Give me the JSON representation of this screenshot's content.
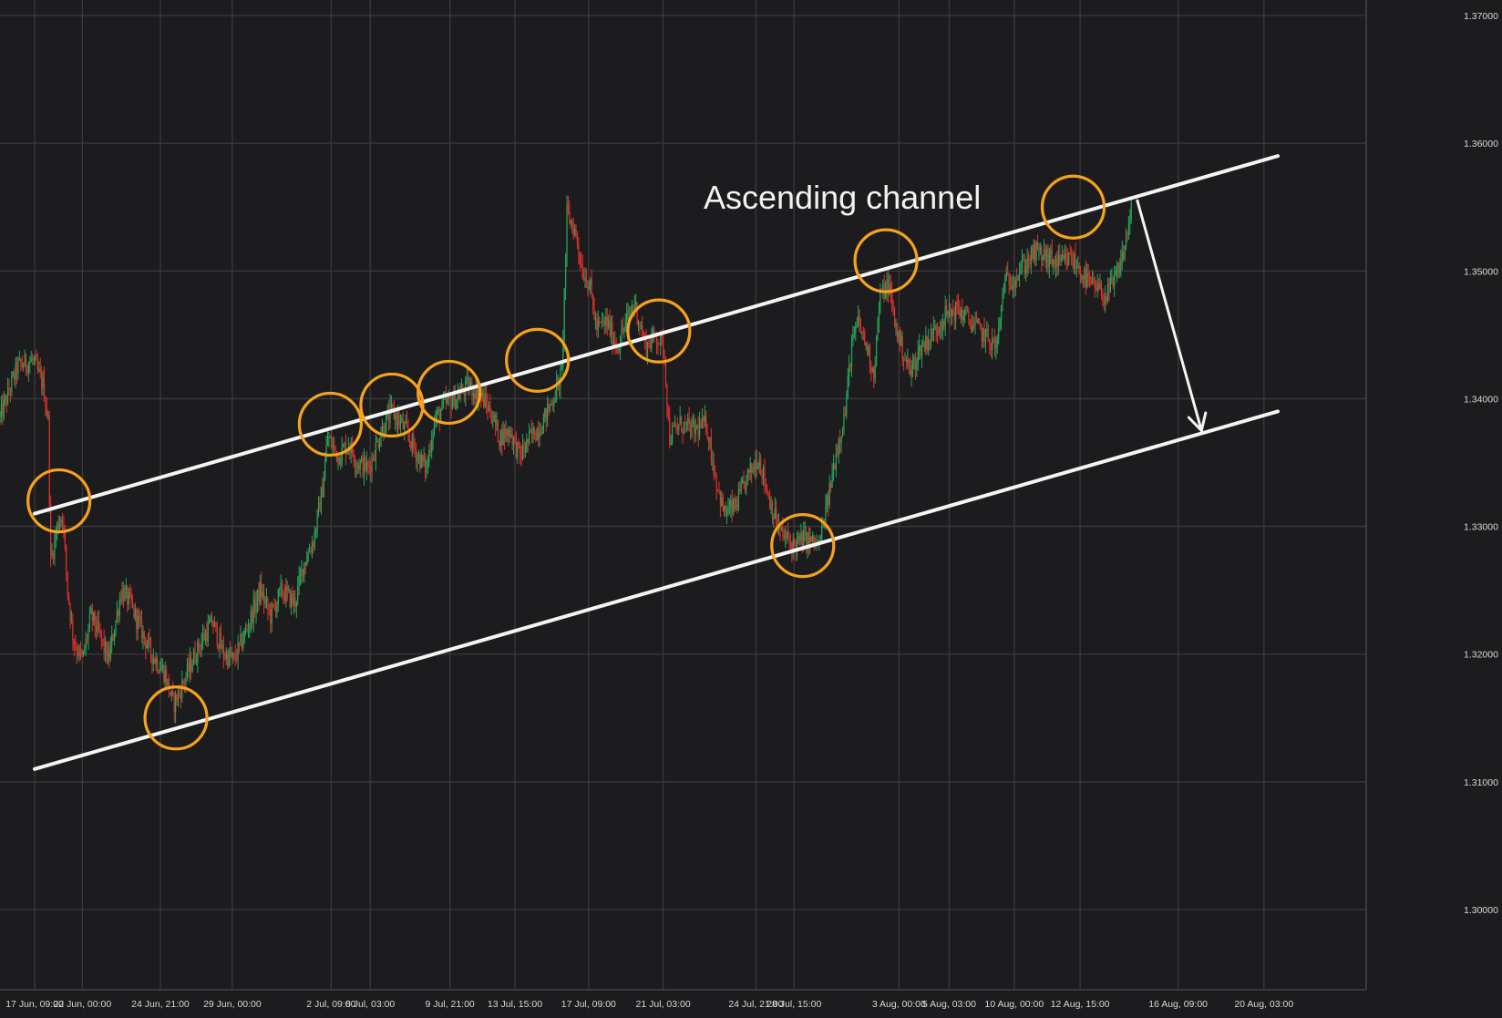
{
  "chart_data": {
    "type": "candlestick",
    "title": "Ascending channel",
    "ylim": [
      1.295,
      1.3705
    ],
    "y_ticks": [
      "1.30000",
      "1.31000",
      "1.32000",
      "1.33000",
      "1.34000",
      "1.35000",
      "1.36000",
      "1.37000"
    ],
    "y_tick_values": [
      1.3,
      1.31,
      1.32,
      1.33,
      1.34,
      1.35,
      1.36,
      1.37
    ],
    "x_ticks": [
      "17 Jun, 09:00",
      "22 Jun, 00:00",
      "24 Jun, 21:00",
      "29 Jun, 00:00",
      "2 Jul, 09:00",
      "6 Jul, 03:00",
      "9 Jul, 21:00",
      "13 Jul, 15:00",
      "17 Jul, 09:00",
      "21 Jul, 03:00",
      "24 Jul, 21:00",
      "28 Jul, 15:00",
      "3 Aug, 00:00",
      "5 Aug, 03:00",
      "10 Aug, 00:00",
      "12 Aug, 15:00",
      "16 Aug, 09:00",
      "20 Aug, 03:00"
    ],
    "x_tick_index": [
      40,
      95,
      185,
      268,
      382,
      427,
      519,
      594,
      679,
      765,
      872,
      916,
      1037,
      1095,
      1170,
      1246,
      1359,
      1458
    ],
    "grid": true,
    "colors": {
      "up": "#26a65b",
      "down": "#e0312c",
      "channel": "#f4f4f4",
      "touch": "#f6a21e",
      "background": "#1c1c1e",
      "grid": "#3a3a3d"
    },
    "price_path": [
      [
        0,
        1.3385
      ],
      [
        20,
        1.3425
      ],
      [
        38,
        1.343
      ],
      [
        50,
        1.341
      ],
      [
        56,
        1.338
      ],
      [
        58,
        1.327
      ],
      [
        66,
        1.33
      ],
      [
        72,
        1.331
      ],
      [
        78,
        1.325
      ],
      [
        85,
        1.321
      ],
      [
        95,
        1.3195
      ],
      [
        105,
        1.323
      ],
      [
        115,
        1.3215
      ],
      [
        125,
        1.3195
      ],
      [
        140,
        1.325
      ],
      [
        150,
        1.324
      ],
      [
        162,
        1.322
      ],
      [
        175,
        1.32
      ],
      [
        190,
        1.3185
      ],
      [
        200,
        1.316
      ],
      [
        210,
        1.3175
      ],
      [
        222,
        1.3195
      ],
      [
        232,
        1.321
      ],
      [
        245,
        1.3225
      ],
      [
        258,
        1.32
      ],
      [
        270,
        1.3195
      ],
      [
        285,
        1.322
      ],
      [
        300,
        1.325
      ],
      [
        312,
        1.323
      ],
      [
        325,
        1.325
      ],
      [
        340,
        1.324
      ],
      [
        350,
        1.327
      ],
      [
        362,
        1.329
      ],
      [
        372,
        1.333
      ],
      [
        378,
        1.337
      ],
      [
        390,
        1.3355
      ],
      [
        402,
        1.3365
      ],
      [
        412,
        1.335
      ],
      [
        425,
        1.3345
      ],
      [
        440,
        1.3375
      ],
      [
        452,
        1.339
      ],
      [
        468,
        1.3375
      ],
      [
        482,
        1.3355
      ],
      [
        492,
        1.3345
      ],
      [
        500,
        1.338
      ],
      [
        512,
        1.3395
      ],
      [
        525,
        1.34
      ],
      [
        540,
        1.341
      ],
      [
        552,
        1.3405
      ],
      [
        566,
        1.339
      ],
      [
        576,
        1.337
      ],
      [
        588,
        1.3375
      ],
      [
        600,
        1.3355
      ],
      [
        612,
        1.337
      ],
      [
        625,
        1.338
      ],
      [
        638,
        1.34
      ],
      [
        648,
        1.342
      ],
      [
        654,
        1.3545
      ],
      [
        664,
        1.353
      ],
      [
        672,
        1.35
      ],
      [
        680,
        1.349
      ],
      [
        688,
        1.3455
      ],
      [
        700,
        1.346
      ],
      [
        712,
        1.344
      ],
      [
        722,
        1.346
      ],
      [
        732,
        1.3475
      ],
      [
        745,
        1.344
      ],
      [
        756,
        1.345
      ],
      [
        766,
        1.344
      ],
      [
        772,
        1.337
      ],
      [
        785,
        1.338
      ],
      [
        800,
        1.3375
      ],
      [
        815,
        1.338
      ],
      [
        825,
        1.334
      ],
      [
        835,
        1.331
      ],
      [
        848,
        1.3315
      ],
      [
        860,
        1.3335
      ],
      [
        875,
        1.3355
      ],
      [
        888,
        1.332
      ],
      [
        900,
        1.3295
      ],
      [
        915,
        1.3285
      ],
      [
        928,
        1.329
      ],
      [
        945,
        1.3285
      ],
      [
        955,
        1.332
      ],
      [
        965,
        1.336
      ],
      [
        975,
        1.339
      ],
      [
        982,
        1.344
      ],
      [
        990,
        1.346
      ],
      [
        1000,
        1.344
      ],
      [
        1008,
        1.342
      ],
      [
        1015,
        1.348
      ],
      [
        1025,
        1.349
      ],
      [
        1032,
        1.346
      ],
      [
        1040,
        1.344
      ],
      [
        1050,
        1.342
      ],
      [
        1062,
        1.344
      ],
      [
        1075,
        1.345
      ],
      [
        1090,
        1.3465
      ],
      [
        1105,
        1.347
      ],
      [
        1120,
        1.346
      ],
      [
        1135,
        1.345
      ],
      [
        1150,
        1.344
      ],
      [
        1158,
        1.349
      ],
      [
        1170,
        1.3495
      ],
      [
        1182,
        1.3505
      ],
      [
        1195,
        1.3515
      ],
      [
        1208,
        1.351
      ],
      [
        1222,
        1.3505
      ],
      [
        1236,
        1.351
      ],
      [
        1246,
        1.35
      ],
      [
        1256,
        1.349
      ],
      [
        1266,
        1.3485
      ],
      [
        1276,
        1.348
      ],
      [
        1288,
        1.3495
      ],
      [
        1298,
        1.352
      ],
      [
        1306,
        1.3555
      ]
    ],
    "channel_lines": [
      {
        "name": "",
        "start": [
          40,
          1.331
        ],
        "end": [
          1474,
          1.359
        ]
      },
      {
        "name": "",
        "start": [
          40,
          1.311
        ],
        "end": [
          1474,
          1.339
        ]
      }
    ],
    "touch_points": [
      [
        68,
        1.332
      ],
      [
        203,
        1.315
      ],
      [
        381,
        1.338
      ],
      [
        452,
        1.3395
      ],
      [
        518,
        1.3405
      ],
      [
        620,
        1.343
      ],
      [
        760,
        1.3453
      ],
      [
        926,
        1.3285
      ],
      [
        1022,
        1.3508
      ],
      [
        1238,
        1.355
      ]
    ],
    "projection_arrow": {
      "from": [
        1312,
        1.3555
      ],
      "to": [
        1386,
        1.3375
      ]
    }
  }
}
